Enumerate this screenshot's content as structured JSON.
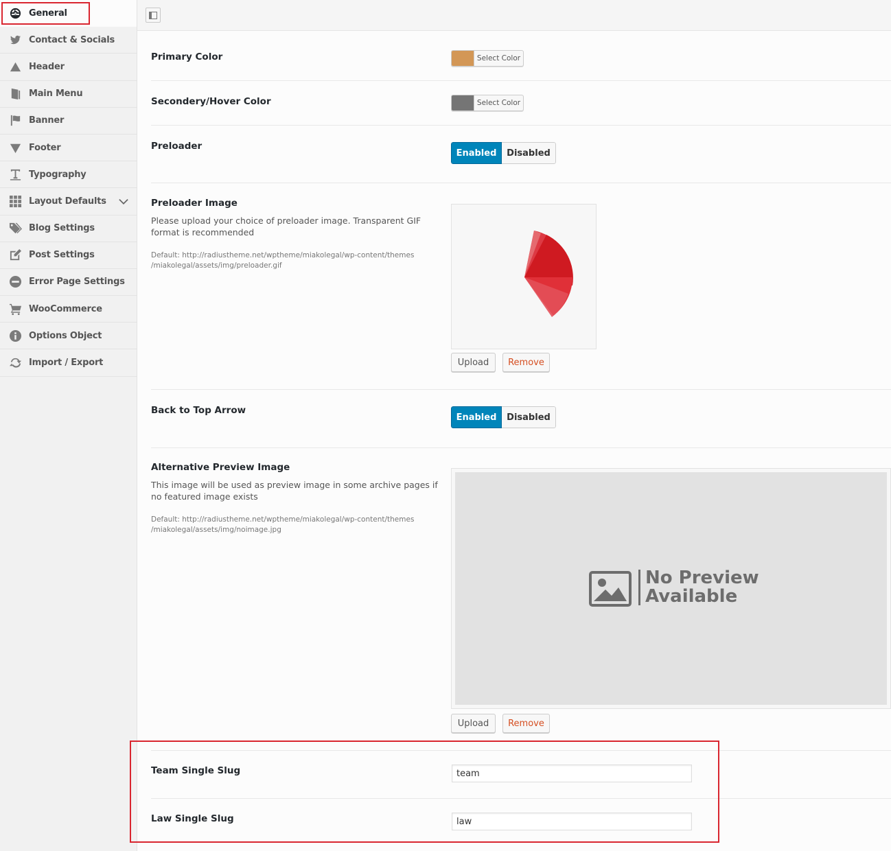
{
  "sidebar": {
    "items": [
      {
        "label": "General",
        "icon": "dashboard-icon"
      },
      {
        "label": "Contact & Socials",
        "icon": "twitter-icon"
      },
      {
        "label": "Header",
        "icon": "triangle-up-icon"
      },
      {
        "label": "Main Menu",
        "icon": "book-icon"
      },
      {
        "label": "Banner",
        "icon": "flag-icon"
      },
      {
        "label": "Footer",
        "icon": "triangle-down-icon"
      },
      {
        "label": "Typography",
        "icon": "text-cursor-icon"
      },
      {
        "label": "Layout Defaults",
        "icon": "grid-icon"
      },
      {
        "label": "Blog Settings",
        "icon": "tags-icon"
      },
      {
        "label": "Post Settings",
        "icon": "edit-icon"
      },
      {
        "label": "Error Page Settings",
        "icon": "minus-circle-icon"
      },
      {
        "label": "WooCommerce",
        "icon": "cart-icon"
      },
      {
        "label": "Options Object",
        "icon": "info-icon"
      },
      {
        "label": "Import / Export",
        "icon": "refresh-icon"
      }
    ]
  },
  "fields": {
    "primary_color": {
      "label": "Primary Color",
      "button": "Select Color",
      "color": "#d39756"
    },
    "secondary_color": {
      "label": "Secondery/Hover Color",
      "button": "Select Color",
      "color": "#757575"
    },
    "preloader": {
      "label": "Preloader",
      "on": "Enabled",
      "off": "Disabled"
    },
    "preloader_image": {
      "label": "Preloader Image",
      "description": "Please upload your choice of preloader image. Transparent GIF format is recommended",
      "default_line1": "Default: http://radiustheme.net/wptheme/miakolegal/wp-content/themes",
      "default_line2": "/miakolegal/assets/img/preloader.gif",
      "upload": "Upload",
      "remove": "Remove"
    },
    "back_to_top": {
      "label": "Back to Top Arrow",
      "on": "Enabled",
      "off": "Disabled"
    },
    "alt_preview": {
      "label": "Alternative Preview Image",
      "description": "This image will be used as preview image in some archive pages if no featured image exists",
      "default_line1": "Default: http://radiustheme.net/wptheme/miakolegal/wp-content/themes",
      "default_line2": "/miakolegal/assets/img/noimage.jpg",
      "no_preview_line1": "No Preview",
      "no_preview_line2": "Available",
      "upload": "Upload",
      "remove": "Remove"
    },
    "team_slug": {
      "label": "Team Single Slug",
      "value": "team"
    },
    "law_slug": {
      "label": "Law Single Slug",
      "value": "law"
    }
  },
  "colors": {
    "accent": "#0085ba",
    "highlight": "#d9252f",
    "remove": "#d54e21"
  }
}
